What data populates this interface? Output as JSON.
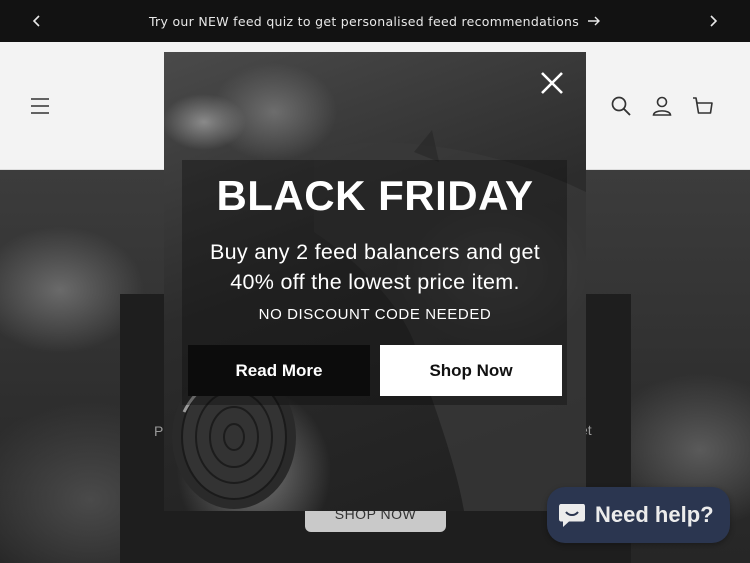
{
  "announcement": {
    "text": "Try our NEW feed quiz to get personalised feed recommendations"
  },
  "hero": {
    "text_left": "P",
    "text_right": "et",
    "button_label": "SHOP NOW"
  },
  "popup": {
    "title": "BLACK FRIDAY",
    "subtitle_line1": "Buy any 2 feed balancers and get",
    "subtitle_line2": "40% off the lowest price item.",
    "note": "NO DISCOUNT CODE NEEDED",
    "read_more_label": "Read More",
    "shop_now_label": "Shop Now"
  },
  "chat": {
    "label": "Need help?"
  },
  "colors": {
    "announcement_bg": "#121212",
    "header_bg": "#f3f3f3",
    "chat_bg": "#2b3650",
    "popup_primary_btn": "#0c0c0c",
    "popup_secondary_btn": "#ffffff"
  },
  "icons": [
    "chevron-left-icon",
    "chevron-right-icon",
    "arrow-right-icon",
    "hamburger-menu-icon",
    "search-icon",
    "account-icon",
    "cart-icon",
    "close-icon",
    "chat-bubble-icon"
  ]
}
